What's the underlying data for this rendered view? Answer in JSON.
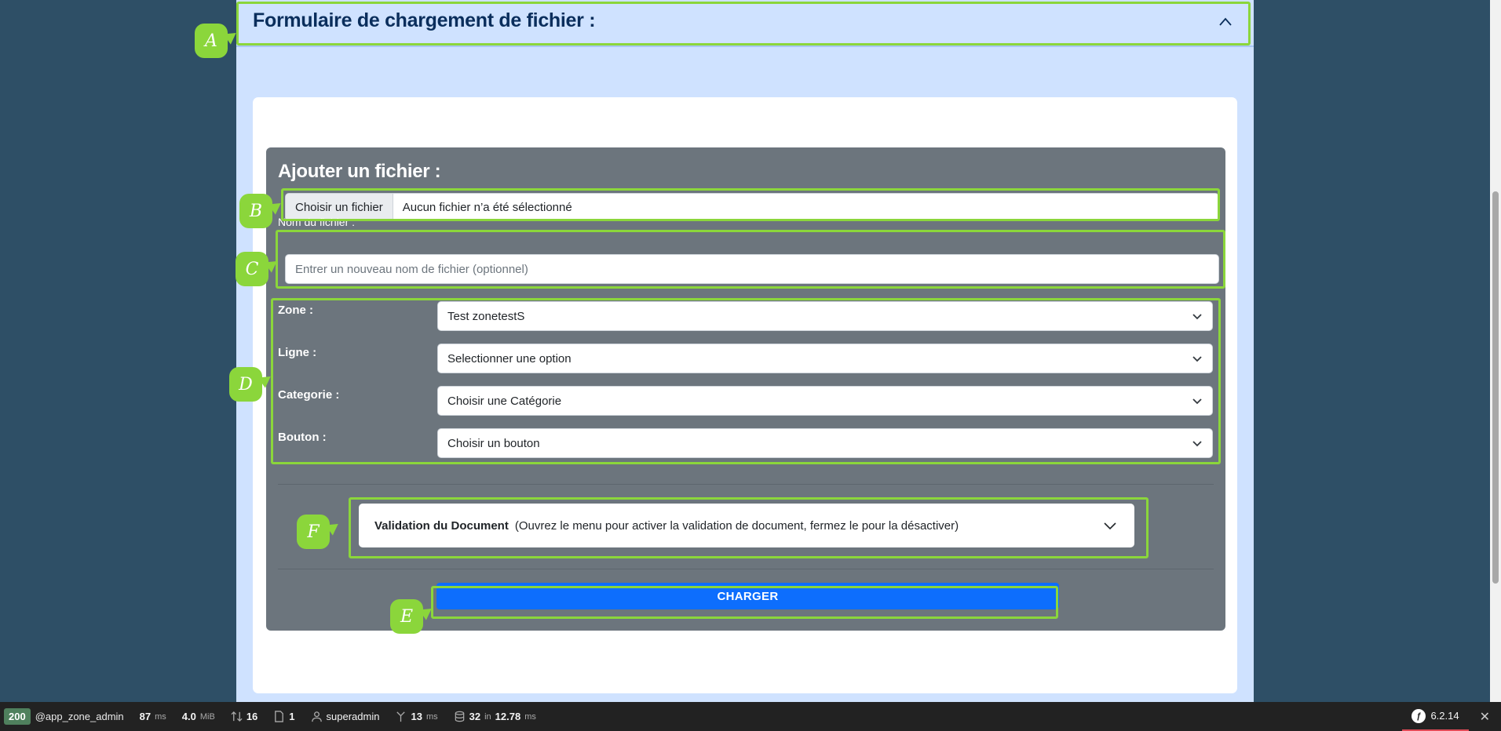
{
  "accordion": {
    "title": "Formulaire de chargement de fichier :",
    "chevron_icon": "chevron-up-icon"
  },
  "form": {
    "heading": "Ajouter un fichier :",
    "file_input": {
      "button_label": "Choisir un fichier",
      "status": "Aucun fichier n’a été sélectionné"
    },
    "filename": {
      "label": "Nom du fichier :",
      "placeholder": "Entrer un nouveau nom de fichier (optionnel)"
    },
    "selects": [
      {
        "label": "Zone :",
        "value": "Test zonetestS"
      },
      {
        "label": "Ligne :",
        "value": "Selectionner une option"
      },
      {
        "label": "Categorie :",
        "value": "Choisir une Catégorie"
      },
      {
        "label": "Bouton :",
        "value": "Choisir un bouton"
      }
    ],
    "validation": {
      "title": "Validation du Document",
      "description": "(Ouvrez le menu pour activer la validation de document, fermez le pour la désactiver)"
    },
    "submit_label": "CHARGER"
  },
  "annotations": [
    "A",
    "B",
    "C",
    "D",
    "E",
    "F"
  ],
  "toolbar": {
    "status_code": "200",
    "route": "@app_zone_admin",
    "time_value": "87",
    "time_unit": "ms",
    "memory_value": "4.0",
    "memory_unit": "MiB",
    "requests": "16",
    "forms": "1",
    "user": "superadmin",
    "events_value": "13",
    "events_unit": "ms",
    "db_queries": "32",
    "db_in": "in",
    "db_time": "12.78",
    "db_unit": "ms",
    "sf_version": "6.2.14"
  },
  "colors": {
    "background": "#2e4f66",
    "accordion_bg": "#cfe2ff",
    "panel_bg": "#6c757d",
    "primary": "#0d6efd",
    "highlight": "#8bd63b"
  }
}
